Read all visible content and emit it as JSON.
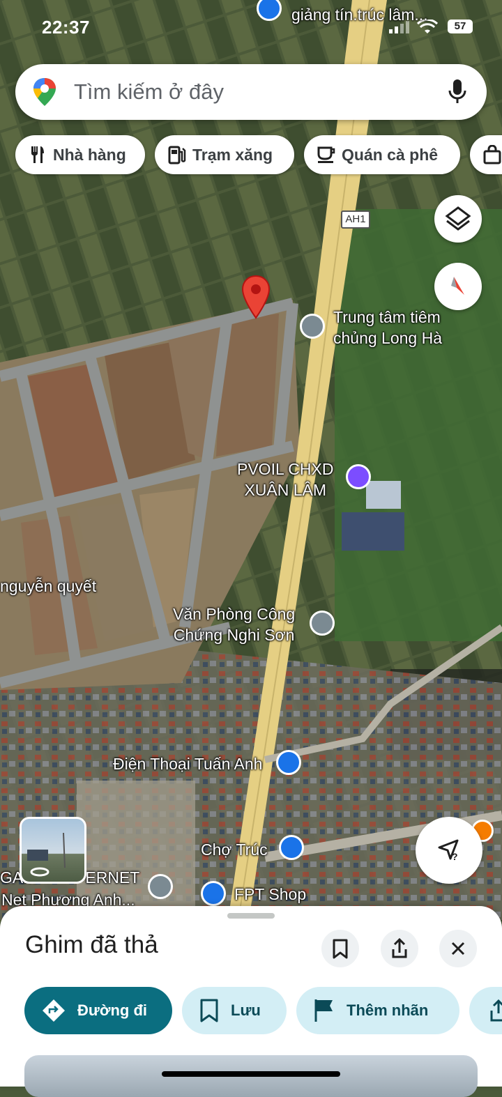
{
  "status_bar": {
    "time": "22:37",
    "battery": "57"
  },
  "search": {
    "placeholder": "Tìm kiếm ở đây"
  },
  "chips": [
    {
      "label": "Nhà hàng",
      "icon": "restaurant-icon"
    },
    {
      "label": "Trạm xăng",
      "icon": "gas-station-icon"
    },
    {
      "label": "Quán cà phê",
      "icon": "coffee-icon"
    },
    {
      "label": "",
      "icon": "shopping-bag-icon"
    }
  ],
  "map": {
    "road_shield": "AH1",
    "top_label": "giảng tín.trúc lâm...",
    "places": [
      {
        "name_line1": "Trung tâm tiêm",
        "name_line2": "chủng Long Hà"
      },
      {
        "name_line1": "PVOIL CHXD",
        "name_line2": "XUÂN LÂM"
      },
      {
        "name_line1": "nguyễn quyết",
        "name_line2": ""
      },
      {
        "name_line1": "Văn Phòng Công",
        "name_line2": "Chứng Nghi Sơn"
      },
      {
        "name_line1": "Điện Thoại Tuấn Anh",
        "name_line2": ""
      },
      {
        "name_line1": "Chợ Trúc",
        "name_line2": ""
      },
      {
        "name_line1": "FPT Shop",
        "name_line2": ""
      },
      {
        "name_line1": "GAM",
        "name_line2": "ERNET"
      },
      {
        "name_line1": "Net Phương Anh...",
        "name_line2": ""
      }
    ]
  },
  "sheet": {
    "title": "Ghim đã thả",
    "actions": [
      {
        "label": "Đường đi"
      },
      {
        "label": "Lưu"
      },
      {
        "label": "Thêm nhãn"
      }
    ]
  },
  "colors": {
    "accent": "#0b6e80",
    "pin": "#ea4335",
    "chip_light": "#d3eef5"
  }
}
